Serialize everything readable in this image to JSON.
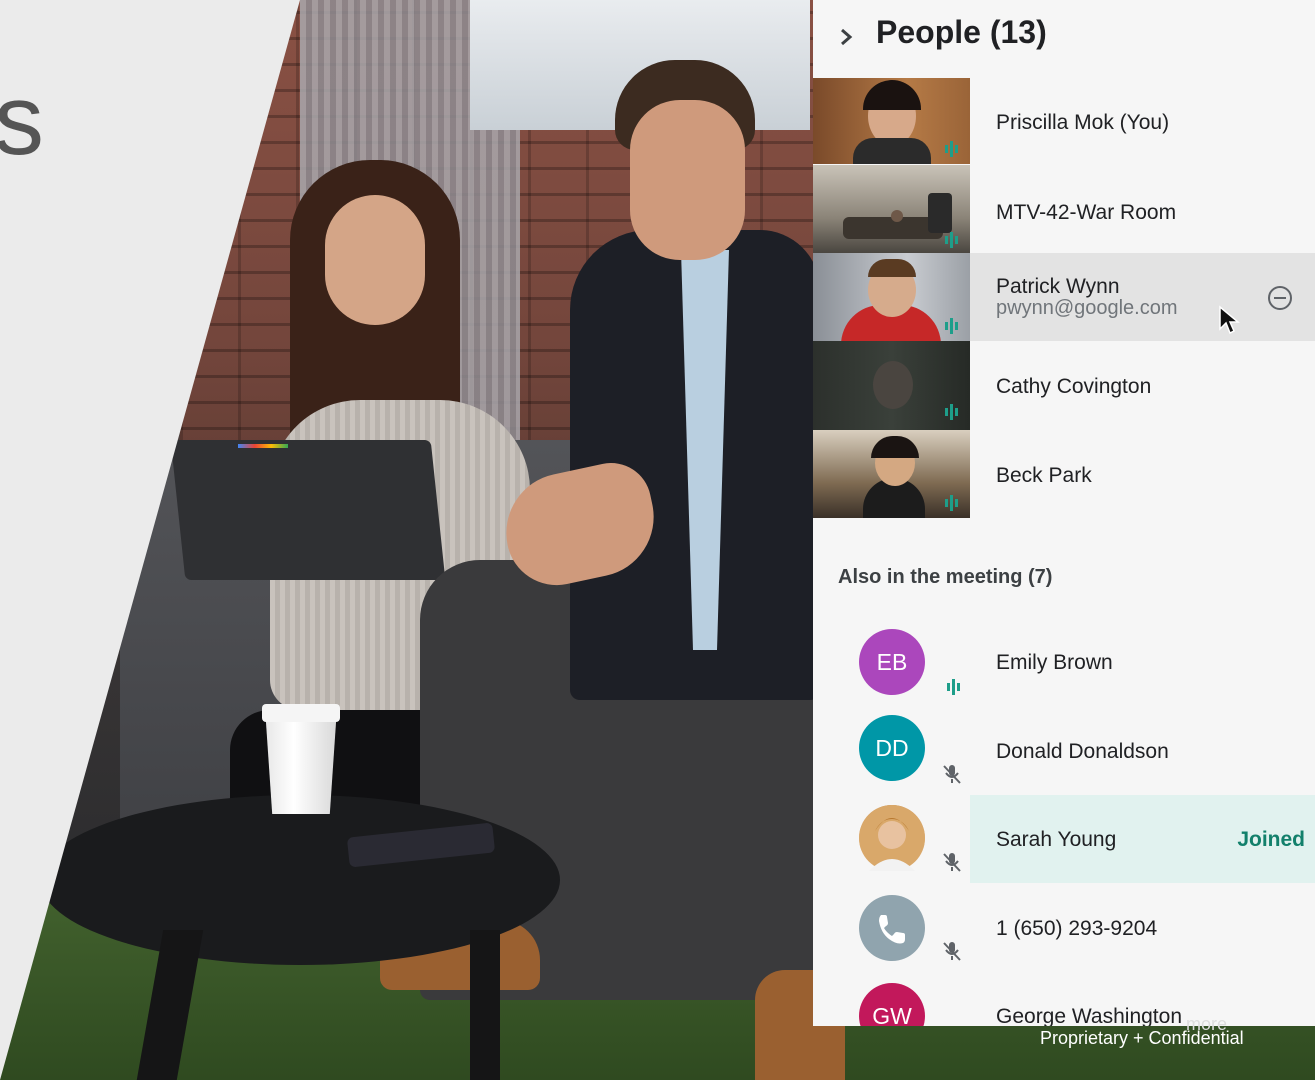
{
  "slide": {
    "partial_char": "s"
  },
  "panel": {
    "title": "People (13)",
    "video_participants": [
      {
        "name": "Priscilla Mok (You)",
        "speaking": true
      },
      {
        "name": "MTV-42-War Room",
        "speaking": true
      },
      {
        "name": "Patrick Wynn",
        "email": "pwynn@google.com",
        "speaking": true,
        "highlighted": true
      },
      {
        "name": "Cathy Covington",
        "speaking": true
      },
      {
        "name": "Beck Park",
        "speaking": true
      }
    ],
    "also_in_meeting_label": "Also in the meeting (7)",
    "others": [
      {
        "initials": "EB",
        "name": "Emily Brown",
        "avatar_color": "#ab47bc",
        "status": "speaking"
      },
      {
        "initials": "DD",
        "name": "Donald Donaldson",
        "avatar_color": "#0097a7",
        "status": "muted"
      },
      {
        "initials": "",
        "name": "Sarah Young",
        "status": "muted",
        "badge": "Joined"
      },
      {
        "initials": "",
        "name": "1 (650) 293-9204",
        "avatar_color": "#90a4ae",
        "status": "muted",
        "icon": "phone-icon"
      },
      {
        "initials": "GW",
        "name": "George Washington",
        "avatar_color": "#c2185b",
        "status": "muted"
      }
    ]
  },
  "footer": {
    "text": "Proprietary + Confidential",
    "overlap_text": "more"
  },
  "colors": {
    "accent": "#12806b",
    "speaking": "#1e9e8a",
    "panel_bg": "#f6f6f6",
    "highlight": "#e3e3e3",
    "joined_bg": "#e1f2ef"
  }
}
